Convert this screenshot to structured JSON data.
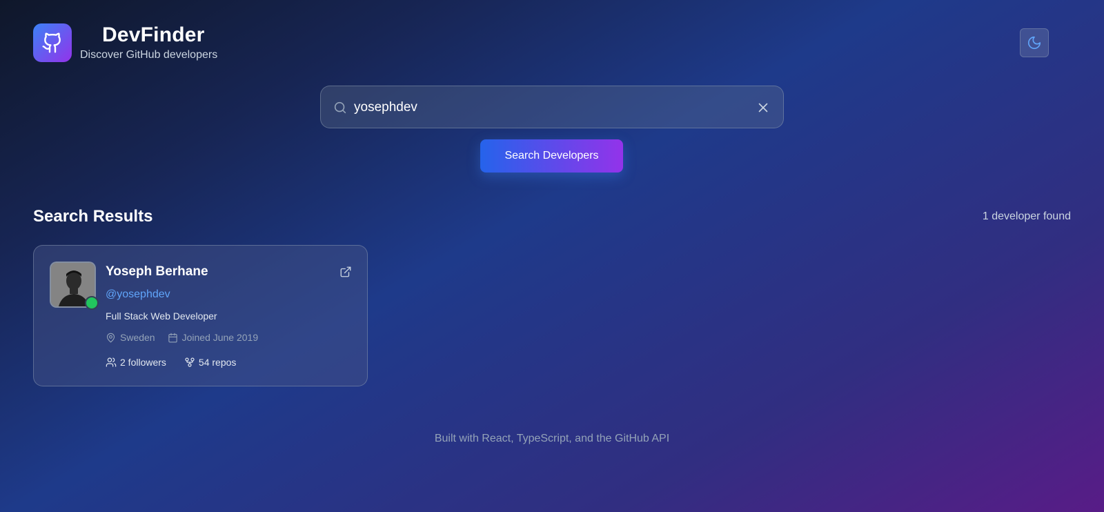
{
  "header": {
    "title": "DevFinder",
    "subtitle": "Discover GitHub developers",
    "logo_icon": "github-icon",
    "theme_icon": "moon-icon"
  },
  "search": {
    "value": "yosephdev",
    "placeholder": "",
    "button_label": "Search Developers"
  },
  "results": {
    "title": "Search Results",
    "count_text": "1 developer found",
    "items": [
      {
        "name": "Yoseph Berhane",
        "handle": "@yosephdev",
        "bio": "Full Stack Web Developer",
        "location": "Sweden",
        "joined": "Joined June 2019",
        "followers": "2 followers",
        "repos": "54 repos",
        "status": "online"
      }
    ]
  },
  "footer": {
    "text": "Built with React, TypeScript, and the GitHub API"
  },
  "colors": {
    "accent_blue": "#2563eb",
    "accent_purple": "#9333ea",
    "link": "#60a5fa",
    "online": "#22c55e"
  }
}
